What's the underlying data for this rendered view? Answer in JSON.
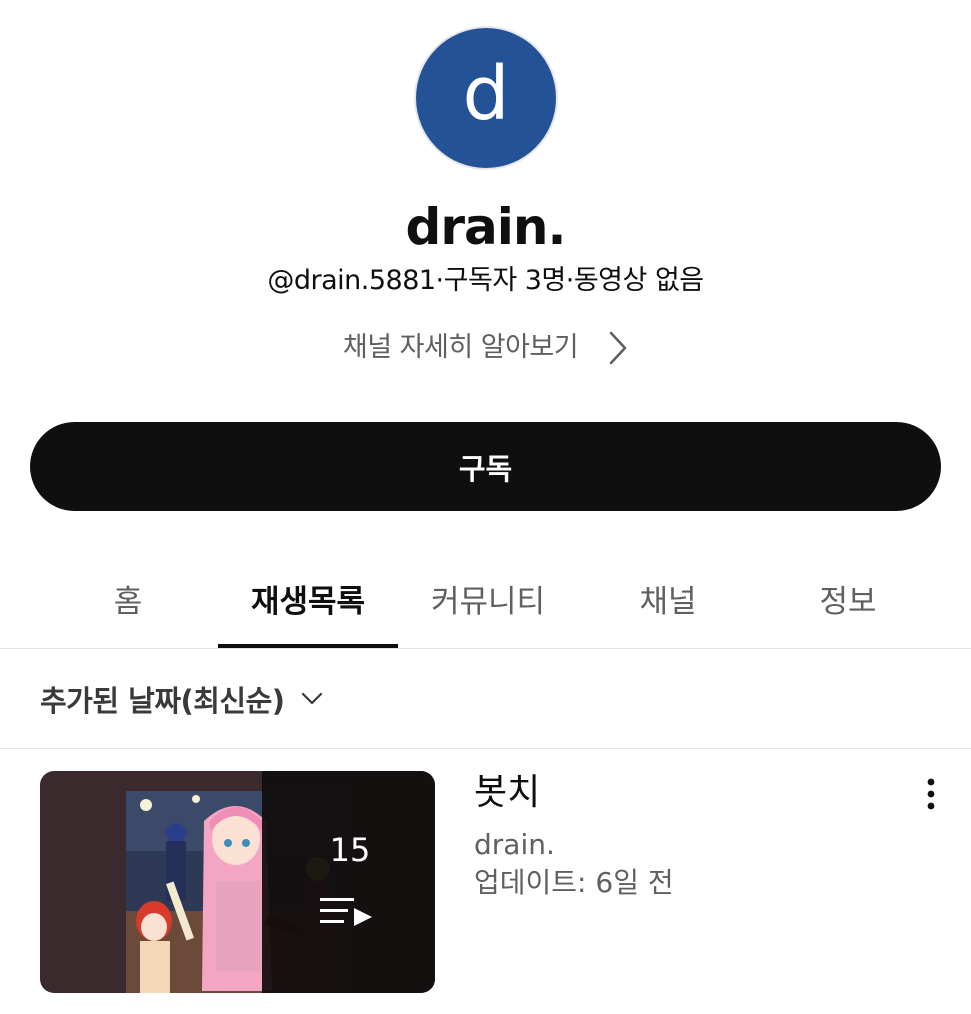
{
  "channel": {
    "avatar_letter": "d",
    "avatar_color": "#235296",
    "name": "drain.",
    "meta": "@drain.5881·구독자 3명·동영상 없음",
    "about_label": "채널 자세히 알아보기",
    "subscribe_label": "구독"
  },
  "tabs": [
    {
      "label": "홈",
      "active": false
    },
    {
      "label": "재생목록",
      "active": true
    },
    {
      "label": "커뮤니티",
      "active": false
    },
    {
      "label": "채널",
      "active": false
    },
    {
      "label": "정보",
      "active": false
    }
  ],
  "sort": {
    "label": "추가된 날짜(최신순)"
  },
  "playlists": [
    {
      "title": "봇치",
      "owner": "drain.",
      "updated": "업데이트: 6일 전",
      "video_count": "15"
    }
  ],
  "icons": {
    "about": "chevron-right-icon",
    "sort": "chevron-down-icon",
    "playlist": "playlist-play-icon",
    "menu": "more-vert-icon"
  },
  "colors": {
    "subscribe_bg": "#0f0f0f",
    "secondary_text": "#606060",
    "divider": "#e5e5e5"
  }
}
